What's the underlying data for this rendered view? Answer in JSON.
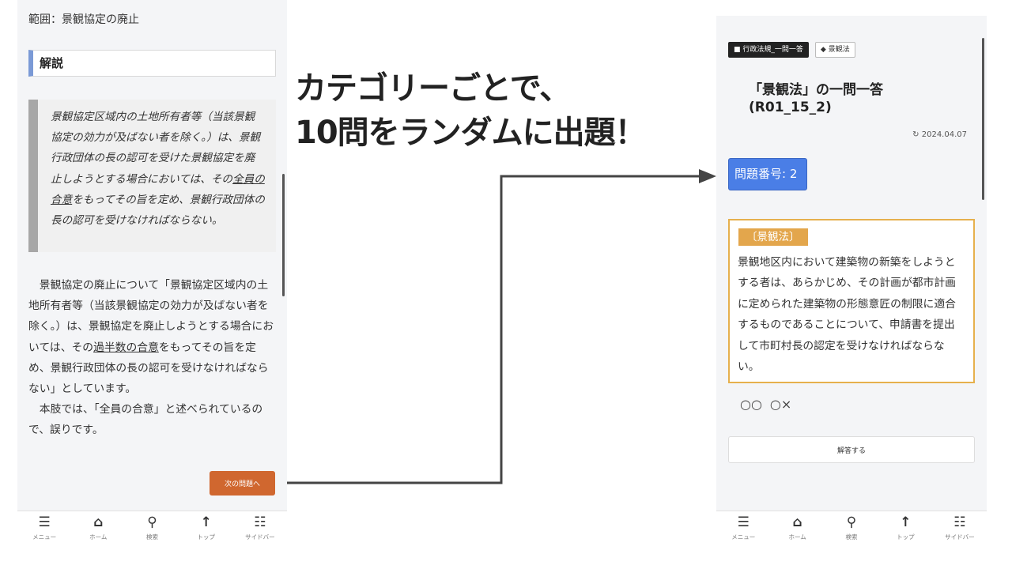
{
  "caption": {
    "line1": "カテゴリーごとで、",
    "line2": "10問をランダムに出題！"
  },
  "left": {
    "scope_line": "範囲：景観協定の廃止",
    "section_heading": "解説",
    "quote": {
      "part1": "景観協定区域内の土地所有者等（当該景観協定の効力が及ばない者を除く。）は、景観行政団体の長の認可を受けた景観協定を廃止しようとする場合においては、その",
      "underlined": "全員の合意",
      "part2": "をもってその旨を定め、景観行政団体の長の認可を受けなければならない。"
    },
    "explanation": {
      "p1_part1": "景観協定の廃止について「景観協定区域内の土地所有者等（当該景観協定の効力が及ばない者を除く。）は、景観協定を廃止しようとする場合においては、その",
      "p1_underlined": "過半数の合意",
      "p1_part2": "をもってその旨を定め、景観行政団体の長の認可を受けなければならない」としています。",
      "p2": "本肢では、「全員の合意」と述べられているので、誤りです。"
    },
    "next_button": "次の問題へ"
  },
  "right": {
    "tags": [
      "行政法規_一問一答",
      "景観法"
    ],
    "title": "「景観法」の一問一答(R01_15_2)",
    "date": "2024.04.07",
    "question_number": "問題番号: 2",
    "question": {
      "category": "〔景観法〕",
      "text": "景観地区内において建築物の新築をしようとする者は、あらかじめ、その計画が都市計画に定められた建築物の形態意匠の制限に適合するものであることについて、申請書を提出して市町村長の認定を受けなければならない。"
    },
    "options": [
      "○○",
      "○×"
    ],
    "answer_button": "解答する"
  },
  "nav": [
    {
      "icon": "menu-icon",
      "glyph": "☰",
      "label": "メニュー"
    },
    {
      "icon": "home-icon",
      "glyph": "⌂",
      "label": "ホーム"
    },
    {
      "icon": "search-icon",
      "glyph": "⚲",
      "label": "検索"
    },
    {
      "icon": "arrow-up-icon",
      "glyph": "↑",
      "label": "トップ"
    },
    {
      "icon": "sidebar-icon",
      "glyph": "☷",
      "label": "サイドバー"
    }
  ],
  "colors": {
    "accent_blue": "#4a7ee6",
    "accent_orange": "#d0672f",
    "question_border": "#e6b04d"
  }
}
